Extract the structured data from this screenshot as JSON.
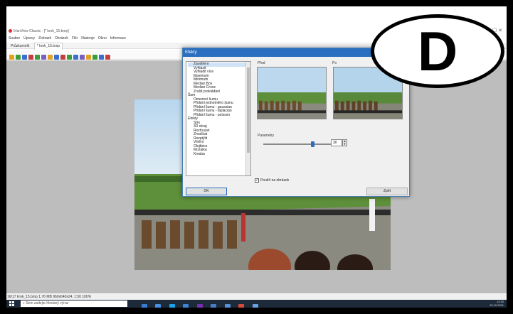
{
  "app": {
    "title": "IrfanView Classic - [* krok_15.bmp]",
    "window_controls": "—  ☐  ✕"
  },
  "menu": {
    "items": [
      "Soubor",
      "Úpravy",
      "Zobrazit",
      "Obrázek",
      "Filtr",
      "Nástroje",
      "Okno",
      "Informace"
    ]
  },
  "tabs": [
    "Průzkumník",
    "* krok_15.bmp"
  ],
  "dialog": {
    "title": "Efekty",
    "effects_tree": [
      {
        "label": "Zaostření",
        "kind": "item",
        "selected": true
      },
      {
        "label": "Vyhlazit",
        "kind": "item"
      },
      {
        "label": "Vyhladit více",
        "kind": "item"
      },
      {
        "label": "Maximum",
        "kind": "item"
      },
      {
        "label": "Minimum",
        "kind": "item"
      },
      {
        "label": "Median Box",
        "kind": "item"
      },
      {
        "label": "Median Cross",
        "kind": "item"
      },
      {
        "label": "Zrušit prokládání",
        "kind": "item"
      },
      {
        "label": "Šum",
        "kind": "cat"
      },
      {
        "label": "Omezení šumu",
        "kind": "item"
      },
      {
        "label": "Přidání jednotného šumu",
        "kind": "item"
      },
      {
        "label": "Přidání šumu - gaussian",
        "kind": "item"
      },
      {
        "label": "Přidání šumu - laplacian",
        "kind": "item"
      },
      {
        "label": "Přidání šumu - poisson",
        "kind": "item"
      },
      {
        "label": "Efekty",
        "kind": "cat"
      },
      {
        "label": "Stín",
        "kind": "item"
      },
      {
        "label": "3D okraj",
        "kind": "item"
      },
      {
        "label": "Rozfouzet",
        "kind": "item"
      },
      {
        "label": "Zmačkat",
        "kind": "item"
      },
      {
        "label": "Rozptýlit",
        "kind": "item"
      },
      {
        "label": "Vlnění",
        "kind": "item"
      },
      {
        "label": "Olejtbice",
        "kind": "item"
      },
      {
        "label": "Mozaika",
        "kind": "item"
      },
      {
        "label": "Kresba",
        "kind": "item"
      }
    ],
    "before_label": "Před",
    "after_label": "Po",
    "params_label": "Parametry",
    "param_value": "30",
    "param_fraction": 0.7,
    "apply_label": "Použít na obrázek",
    "apply_checked": "✓",
    "ok_label": "OK",
    "back_label": "Zpět"
  },
  "statusbar": {
    "text": "16/17  krok_15.bmp  1.76 MB  960x640x24, 1:50  100%"
  },
  "taskbar": {
    "search_placeholder": "Sem zadejte hledaný výraz",
    "time": "12:20",
    "date": "15.10.2021"
  },
  "badge": {
    "letter": "D"
  },
  "colors": {
    "dialog_title": "#2a6fbf",
    "taskbar": "#1c2a3a",
    "workspace": "#bdbdbd"
  }
}
